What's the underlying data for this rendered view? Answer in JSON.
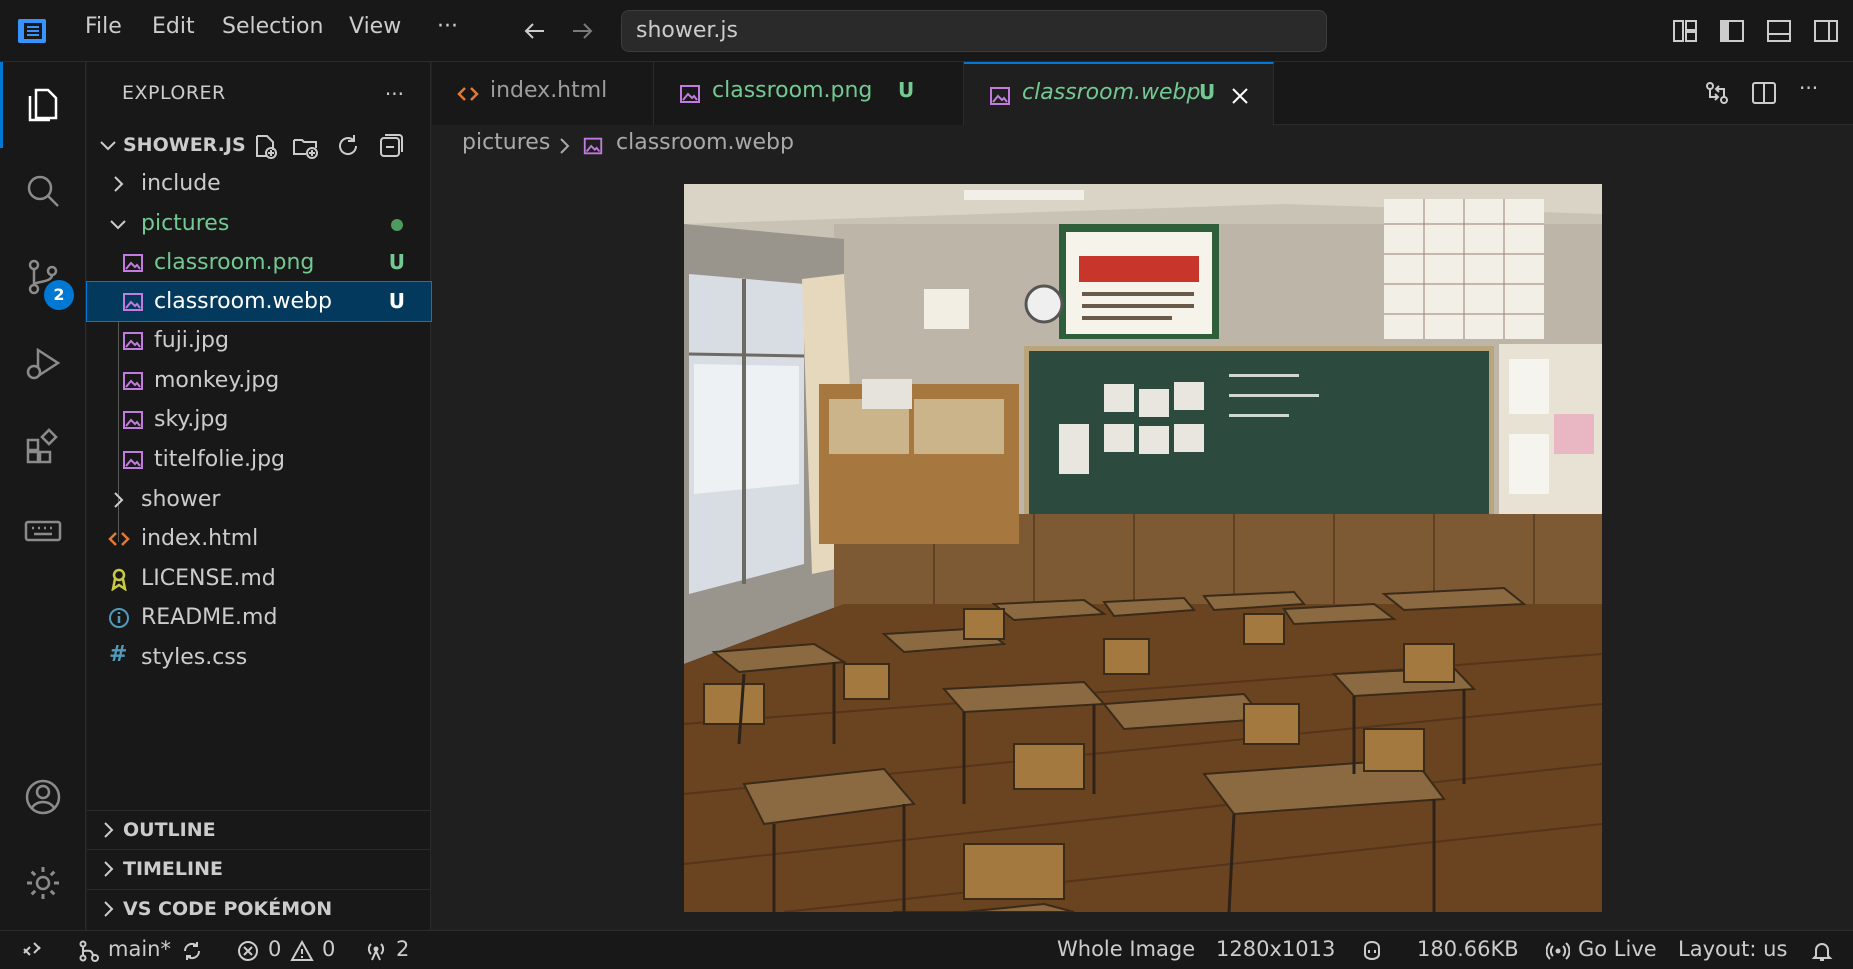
{
  "menu": {
    "file": "File",
    "edit": "Edit",
    "selection": "Selection",
    "view": "View",
    "more": "···"
  },
  "command_center": {
    "text": "shower.js"
  },
  "explorer": {
    "title": "EXPLORER",
    "more": "···",
    "workspace": "SHOWER.JS",
    "tree": [
      {
        "name": "include",
        "type": "folder",
        "expanded": false
      },
      {
        "name": "pictures",
        "type": "folder",
        "expanded": true,
        "modified": true
      },
      {
        "name": "classroom.png",
        "type": "image",
        "status": "U"
      },
      {
        "name": "classroom.webp",
        "type": "image",
        "status": "U",
        "selected": true
      },
      {
        "name": "fuji.jpg",
        "type": "image"
      },
      {
        "name": "monkey.jpg",
        "type": "image"
      },
      {
        "name": "sky.jpg",
        "type": "image"
      },
      {
        "name": "titelfolie.jpg",
        "type": "image"
      },
      {
        "name": "shower",
        "type": "folder",
        "expanded": false
      },
      {
        "name": "index.html",
        "type": "html"
      },
      {
        "name": "LICENSE.md",
        "type": "license"
      },
      {
        "name": "README.md",
        "type": "info"
      },
      {
        "name": "styles.css",
        "type": "css"
      }
    ],
    "outline": "OUTLINE",
    "timeline": "TIMELINE",
    "pokemon": "VS CODE POKÉMON"
  },
  "activity": {
    "scm_badge": "2"
  },
  "tabs": [
    {
      "label": "index.html",
      "icon": "html-icon"
    },
    {
      "label": "classroom.png",
      "icon": "image-icon",
      "status": "U"
    },
    {
      "label": "classroom.webp",
      "icon": "image-icon",
      "status": "U",
      "active": true
    }
  ],
  "breadcrumb": {
    "folder": "pictures",
    "file": "classroom.webp"
  },
  "statusbar": {
    "branch": "main*",
    "errors": "0",
    "warnings": "0",
    "ports": "2",
    "zoom": "Whole Image",
    "dimensions": "1280x1013",
    "filesize": "180.66KB",
    "golive": "Go Live",
    "layout": "Layout: us"
  },
  "colors": {
    "accent": "#0078d4",
    "untracked": "#73c991",
    "image_icon": "#c27ce0",
    "html_icon": "#e37933"
  }
}
